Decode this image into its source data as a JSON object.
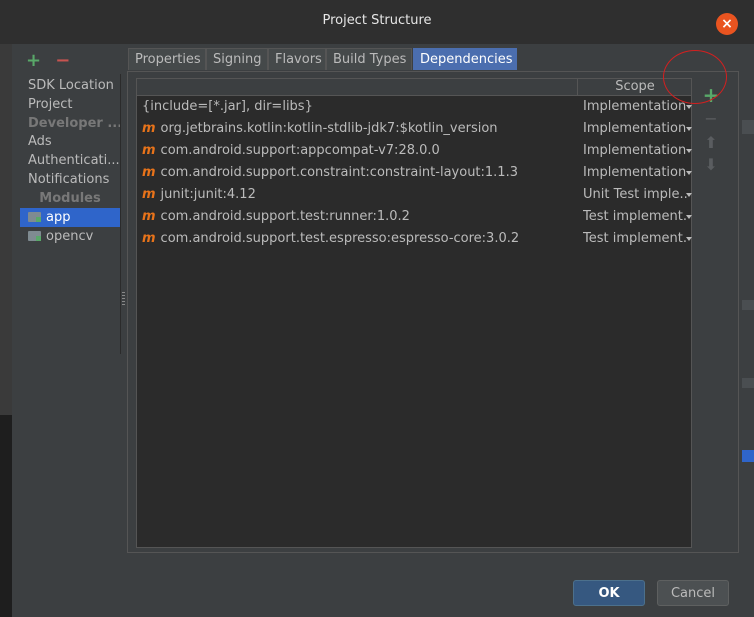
{
  "window": {
    "title": "Project Structure"
  },
  "sidebar": {
    "items": [
      {
        "label": "SDK Location"
      },
      {
        "label": "Project"
      },
      {
        "label": "Developer ..."
      },
      {
        "label": "Ads"
      },
      {
        "label": "Authenticati..."
      },
      {
        "label": "Notifications"
      }
    ],
    "section_label": "Modules",
    "modules": [
      {
        "label": "app",
        "selected": true
      },
      {
        "label": "opencv",
        "selected": false
      }
    ]
  },
  "tabs": [
    {
      "label": "Properties"
    },
    {
      "label": "Signing"
    },
    {
      "label": "Flavors"
    },
    {
      "label": "Build Types"
    },
    {
      "label": "Dependencies",
      "active": true
    }
  ],
  "table": {
    "scope_header": "Scope",
    "rows": [
      {
        "marker": "",
        "dependency": "{include=[*.jar], dir=libs}",
        "scope": "Implementation"
      },
      {
        "marker": "m",
        "dependency": "org.jetbrains.kotlin:kotlin-stdlib-jdk7:$kotlin_version",
        "scope": "Implementation"
      },
      {
        "marker": "m",
        "dependency": "com.android.support:appcompat-v7:28.0.0",
        "scope": "Implementation"
      },
      {
        "marker": "m",
        "dependency": "com.android.support.constraint:constraint-layout:1.1.3",
        "scope": "Implementation"
      },
      {
        "marker": "m",
        "dependency": "junit:junit:4.12",
        "scope": "Unit Test imple..."
      },
      {
        "marker": "m",
        "dependency": "com.android.support.test:runner:1.0.2",
        "scope": "Test implement..."
      },
      {
        "marker": "m",
        "dependency": "com.android.support.test.espresso:espresso-core:3.0.2",
        "scope": "Test implement..."
      }
    ]
  },
  "tools": {
    "add": "+",
    "remove": "−",
    "up": "⬆",
    "down": "⬇"
  },
  "sidebar_tools": {
    "add": "+",
    "remove": "−"
  },
  "close_glyph": "×",
  "buttons": {
    "ok": "OK",
    "cancel": "Cancel"
  },
  "colors": {
    "accent": "#4b6eaf",
    "selection": "#2f65ca",
    "add": "#59a869",
    "maven": "#e8731a",
    "close": "#e95420",
    "highlight": "#d22020"
  }
}
